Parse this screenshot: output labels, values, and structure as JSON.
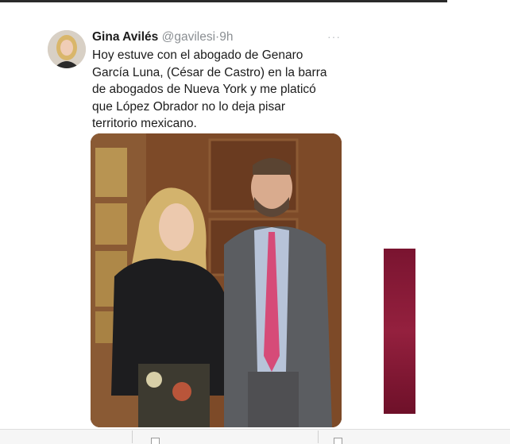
{
  "tweet": {
    "author_name": "Gina Avilés",
    "handle": "@gavilesi",
    "separator": "·",
    "time": "9h",
    "more_glyph": "···",
    "text": "Hoy estuve con el abogado de Genaro García Luna, (César de Castro) en la barra de abogados de Nueva York y me platicó que López Obrador no lo deja pisar territorio mexicano."
  },
  "colors": {
    "side_bar": "#8a1a38",
    "text": "#1c1c1c",
    "muted": "#8b8f93"
  },
  "icons": [
    "more-icon",
    "document-icon"
  ]
}
